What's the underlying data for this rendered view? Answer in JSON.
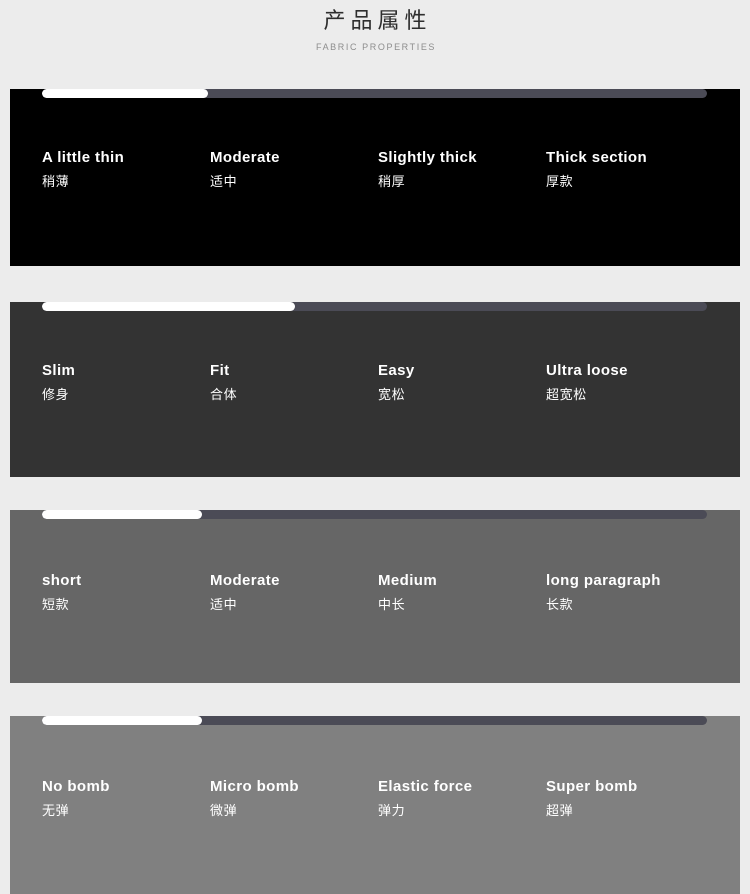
{
  "header": {
    "title": "产品属性",
    "subtitle": "FABRIC PROPERTIES"
  },
  "colors": {
    "page_background": "#ececec",
    "meter_track": "#4b4b56",
    "meter_fill": "#ffffff",
    "text": "#ffffff",
    "panel_1_background": "#000000",
    "panel_2_background": "#333333",
    "panel_3_background": "#666666",
    "panel_4_background": "#808080"
  },
  "panels": [
    {
      "name": "thickness",
      "background": "#000000",
      "meter_fill_percent": 25,
      "options": [
        {
          "en": "A little thin",
          "zh": "稍薄"
        },
        {
          "en": "Moderate",
          "zh": "适中"
        },
        {
          "en": "Slightly thick",
          "zh": "稍厚"
        },
        {
          "en": "Thick section",
          "zh": "厚款"
        }
      ]
    },
    {
      "name": "fit",
      "background": "#333333",
      "meter_fill_percent": 38,
      "options": [
        {
          "en": "Slim",
          "zh": "修身"
        },
        {
          "en": "Fit",
          "zh": "合体"
        },
        {
          "en": "Easy",
          "zh": "宽松"
        },
        {
          "en": "Ultra loose",
          "zh": "超宽松"
        }
      ]
    },
    {
      "name": "length",
      "background": "#666666",
      "meter_fill_percent": 24,
      "options": [
        {
          "en": "short",
          "zh": "短款"
        },
        {
          "en": "Moderate",
          "zh": "适中"
        },
        {
          "en": "Medium",
          "zh": "中长"
        },
        {
          "en": "long paragraph",
          "zh": "长款"
        }
      ]
    },
    {
      "name": "elasticity",
      "background": "#808080",
      "meter_fill_percent": 24,
      "options": [
        {
          "en": "No bomb",
          "zh": "无弹"
        },
        {
          "en": "Micro bomb",
          "zh": "微弹"
        },
        {
          "en": "Elastic force",
          "zh": "弹力"
        },
        {
          "en": "Super bomb",
          "zh": "超弹"
        }
      ]
    }
  ]
}
